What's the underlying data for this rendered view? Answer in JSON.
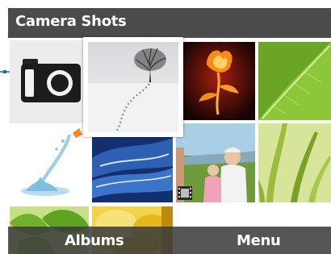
{
  "header": {
    "title": "Camera Shots"
  },
  "gallery": {
    "items": [
      {
        "name": "camera-shots-folder",
        "icon": "camera-icon"
      },
      {
        "name": "snow-tree-photo",
        "selected": true
      },
      {
        "name": "fire-flower-photo"
      },
      {
        "name": "green-leaf-photo"
      },
      {
        "name": "water-splash-photo"
      },
      {
        "name": "blue-wave-photo"
      },
      {
        "name": "family-photo",
        "icon": "film-icon",
        "type": "video"
      },
      {
        "name": "grass-photo"
      },
      {
        "name": "green-leaves-photo"
      },
      {
        "name": "yellow-flower-photo"
      }
    ]
  },
  "softkeys": {
    "left": "Albums",
    "right": "Menu"
  },
  "colors": {
    "title_bar": "#4b4b4b",
    "softkey_bar": "#3a3a3a",
    "text": "#ffffff",
    "pin_accent": "#1f6fb5"
  }
}
